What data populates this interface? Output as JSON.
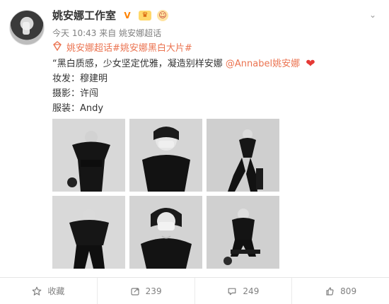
{
  "post": {
    "author": "姚安娜工作室",
    "badges": [
      {
        "name": "verified-icon",
        "glyph": "V"
      },
      {
        "name": "crown-icon",
        "glyph": "♛"
      },
      {
        "name": "fan-face-icon",
        "glyph": "☺"
      }
    ],
    "time": "今天 10:43",
    "source_prefix": "来自",
    "source_name": "姚安娜超话",
    "topic_icon": "diamond-icon",
    "topic_text": "姚安娜超话#姚安娜黑白大片#",
    "text_lead": "“黑白质感，少女坚定优雅，凝造别样安娜",
    "mention": "@Annabel姚安娜",
    "lines": [
      "妆发：穆建明",
      "摄影：许闯",
      "服装：Andy"
    ]
  },
  "footer": {
    "favorite_label": "收藏",
    "repost_count": "239",
    "comment_count": "249",
    "like_count": "809"
  },
  "colors": {
    "accent": "#eb7350",
    "verified": "#ff8200",
    "heart": "#e53935",
    "muted": "#808080"
  }
}
